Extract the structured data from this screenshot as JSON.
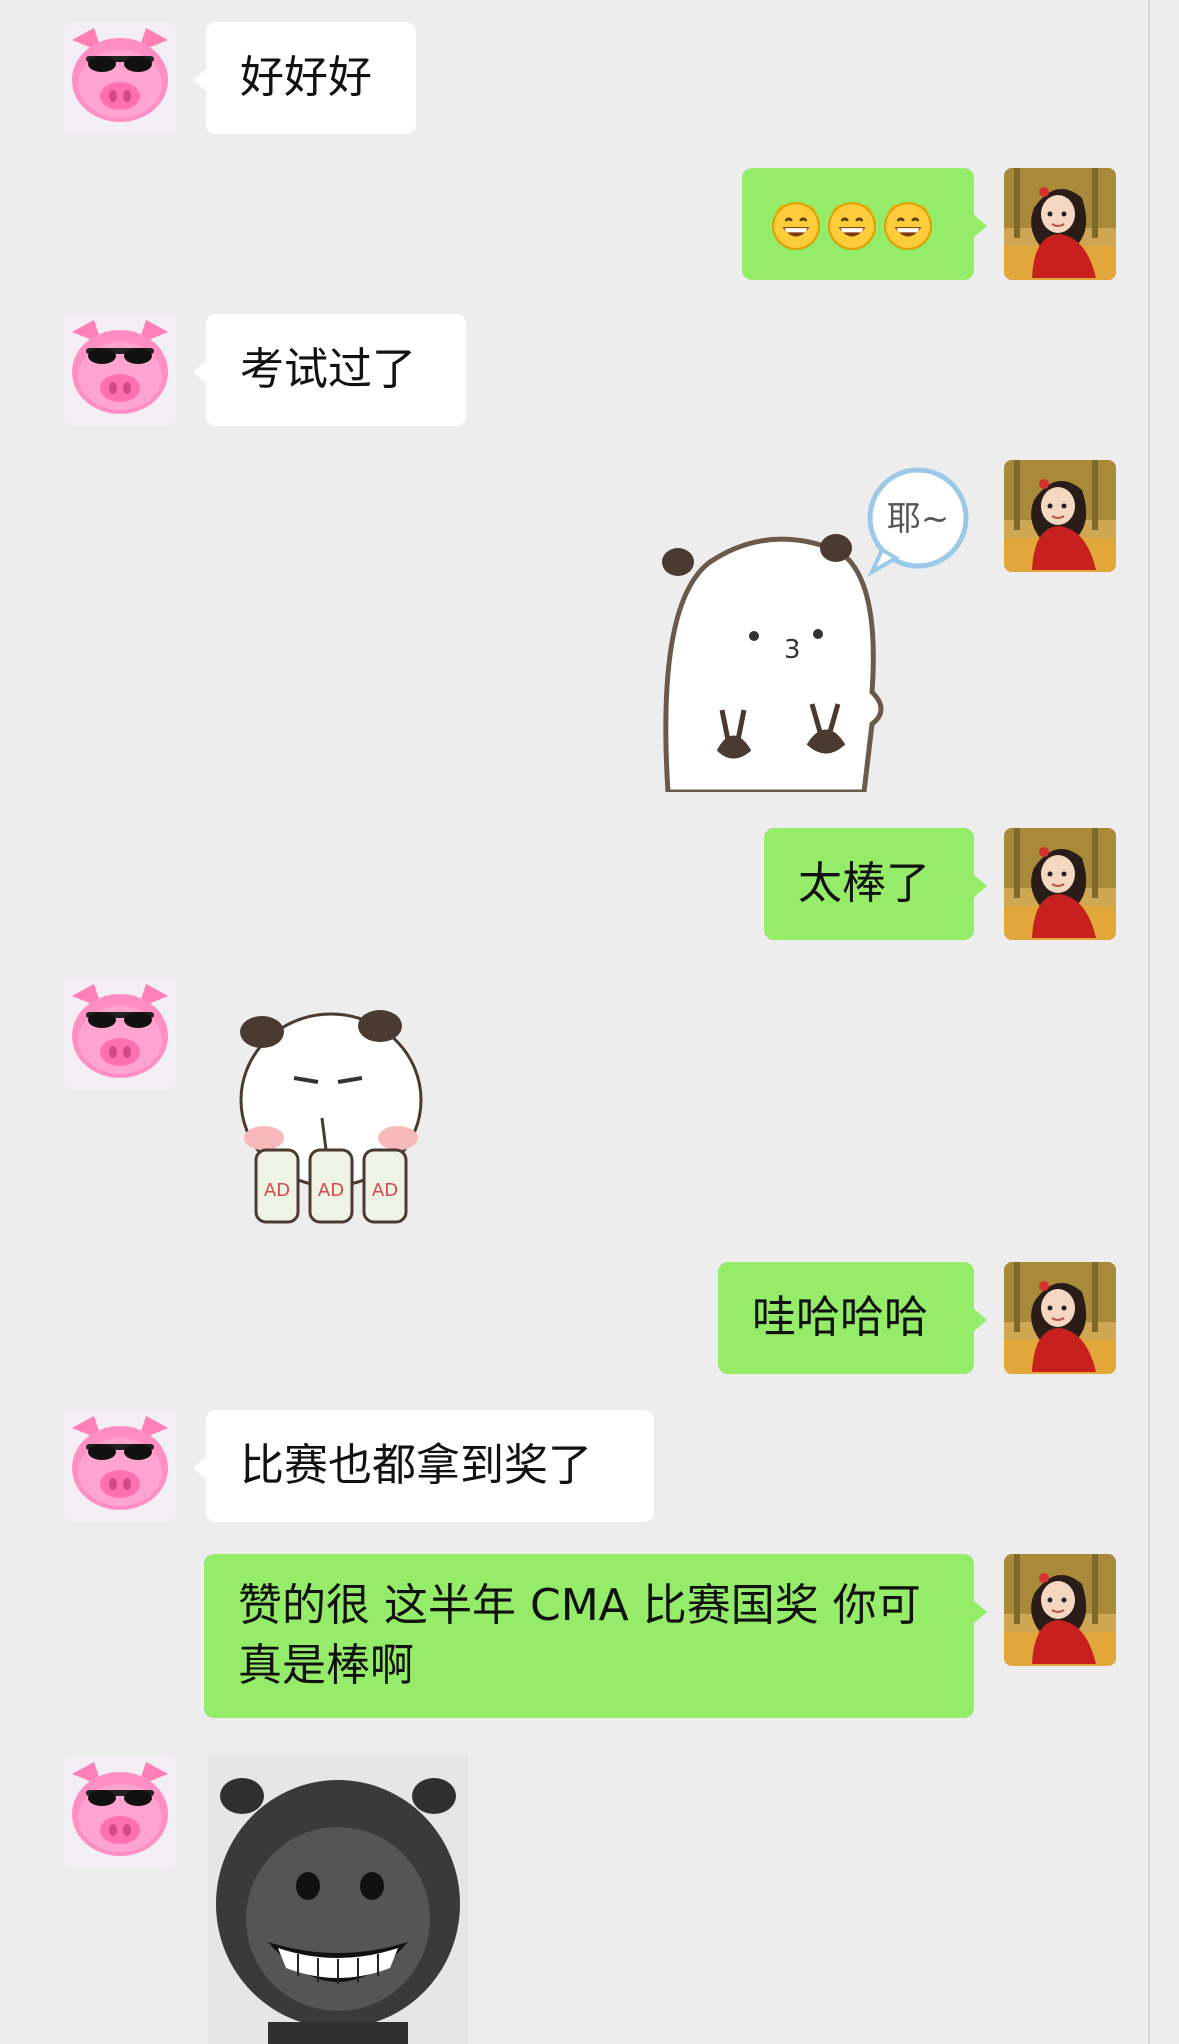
{
  "chat": {
    "messages": [
      {
        "id": "m1",
        "side": "in",
        "type": "text",
        "text": "好好好"
      },
      {
        "id": "m2",
        "side": "out",
        "type": "emoji",
        "emoji": [
          "grinning-face-icon",
          "grinning-face-icon",
          "grinning-face-icon"
        ]
      },
      {
        "id": "m3",
        "side": "in",
        "type": "text",
        "text": "考试过了"
      },
      {
        "id": "m4",
        "side": "out",
        "type": "sticker",
        "sticker": "bear-peace-sticker",
        "caption": "耶~"
      },
      {
        "id": "m5",
        "side": "out",
        "type": "text",
        "text": "太棒了"
      },
      {
        "id": "m6",
        "side": "in",
        "type": "sticker",
        "sticker": "bear-drinks-sticker",
        "caption": "AD"
      },
      {
        "id": "m7",
        "side": "out",
        "type": "text",
        "text": "哇哈哈哈"
      },
      {
        "id": "m8",
        "side": "in",
        "type": "text",
        "text": "比赛也都拿到奖了"
      },
      {
        "id": "m9",
        "side": "out",
        "type": "text",
        "text": "赞的很  这半年 CMA 比赛国奖 你可真是棒啊"
      },
      {
        "id": "m10",
        "side": "in",
        "type": "sticker",
        "sticker": "grinning-black-bear-sticker"
      }
    ]
  },
  "colors": {
    "background": "#ededed",
    "incoming_bubble": "#ffffff",
    "outgoing_bubble": "#95ec69"
  },
  "avatars": {
    "contact": "pig-sunglasses-avatar",
    "self": "girl-red-dress-avatar"
  }
}
